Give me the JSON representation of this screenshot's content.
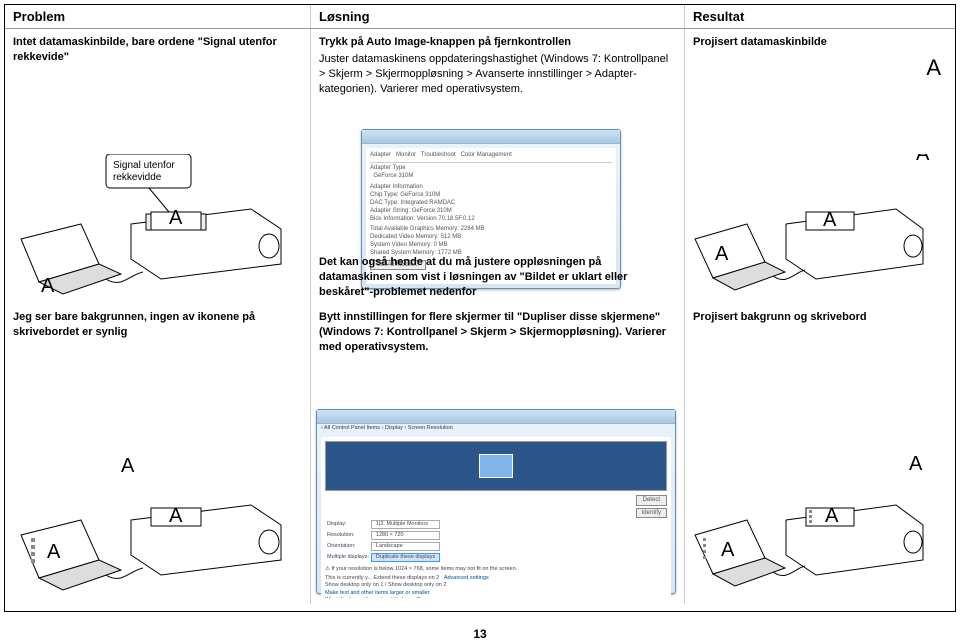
{
  "headers": {
    "problem": "Problem",
    "solution": "Løsning",
    "result": "Resultat"
  },
  "row1": {
    "problem_text": "Intet datamaskinbilde, bare ordene \"Signal utenfor rekkevide\"",
    "callout_text": "Signal utenfor rekkevidde",
    "solution_text_1": "Trykk på Auto Image-knappen på fjernkontrollen",
    "solution_text_2": "Juster datamaskinens oppdateringshastighet (Windows 7: Kontrollpanel > Skjerm > Skjermoppløsning > Avanserte innstillinger > Adapter-kategorien). Varierer med operativsystem.",
    "solution_text_3": "Det kan også hende at du må justere oppløsningen på datamaskinen som vist i løsningen av \"Bildet er uklart eller beskåret\"-problemet nedenfor",
    "result_text": "Projisert datamaskinbilde"
  },
  "row2": {
    "problem_text": "Jeg ser bare bakgrunnen, ingen av ikonene på skrivebordet er synlig",
    "solution_text": "Bytt innstillingen for flere skjermer til \"Dupliser disse skjermene\" (Windows 7: Kontrollpanel > Skjerm > Skjermoppløsning). Varierer med operativsystem.",
    "result_text": "Projisert bakgrunn og skrivebord"
  },
  "fakewin2": {
    "label_display": "Display:",
    "label_resolution": "Resolution:",
    "label_orientation": "Orientation:",
    "label_multiple": "Multiple displays:",
    "val_display": "1|2. Multiple Monitors",
    "val_resolution": "1280 × 720",
    "val_orientation": "Landscape",
    "val_multiple": "Duplicate these displays",
    "warn": "If your resolution is below 1024 × 768, some items may not fit on the screen.",
    "link1": "Advanced settings",
    "note1": "This is currently y... Extend these displays on 2",
    "note2": "Show desktop only on 1 / Show desktop only on 2",
    "link2": "Make text and other items larger or smaller",
    "link3": "What display settings should I choose?",
    "btn_detect": "Detect",
    "btn_identify": "Identify",
    "breadcrumb": "‹ All Control Panel Items › Display › Screen Resolution"
  },
  "labels": {
    "A": "A"
  },
  "page_number": "13"
}
